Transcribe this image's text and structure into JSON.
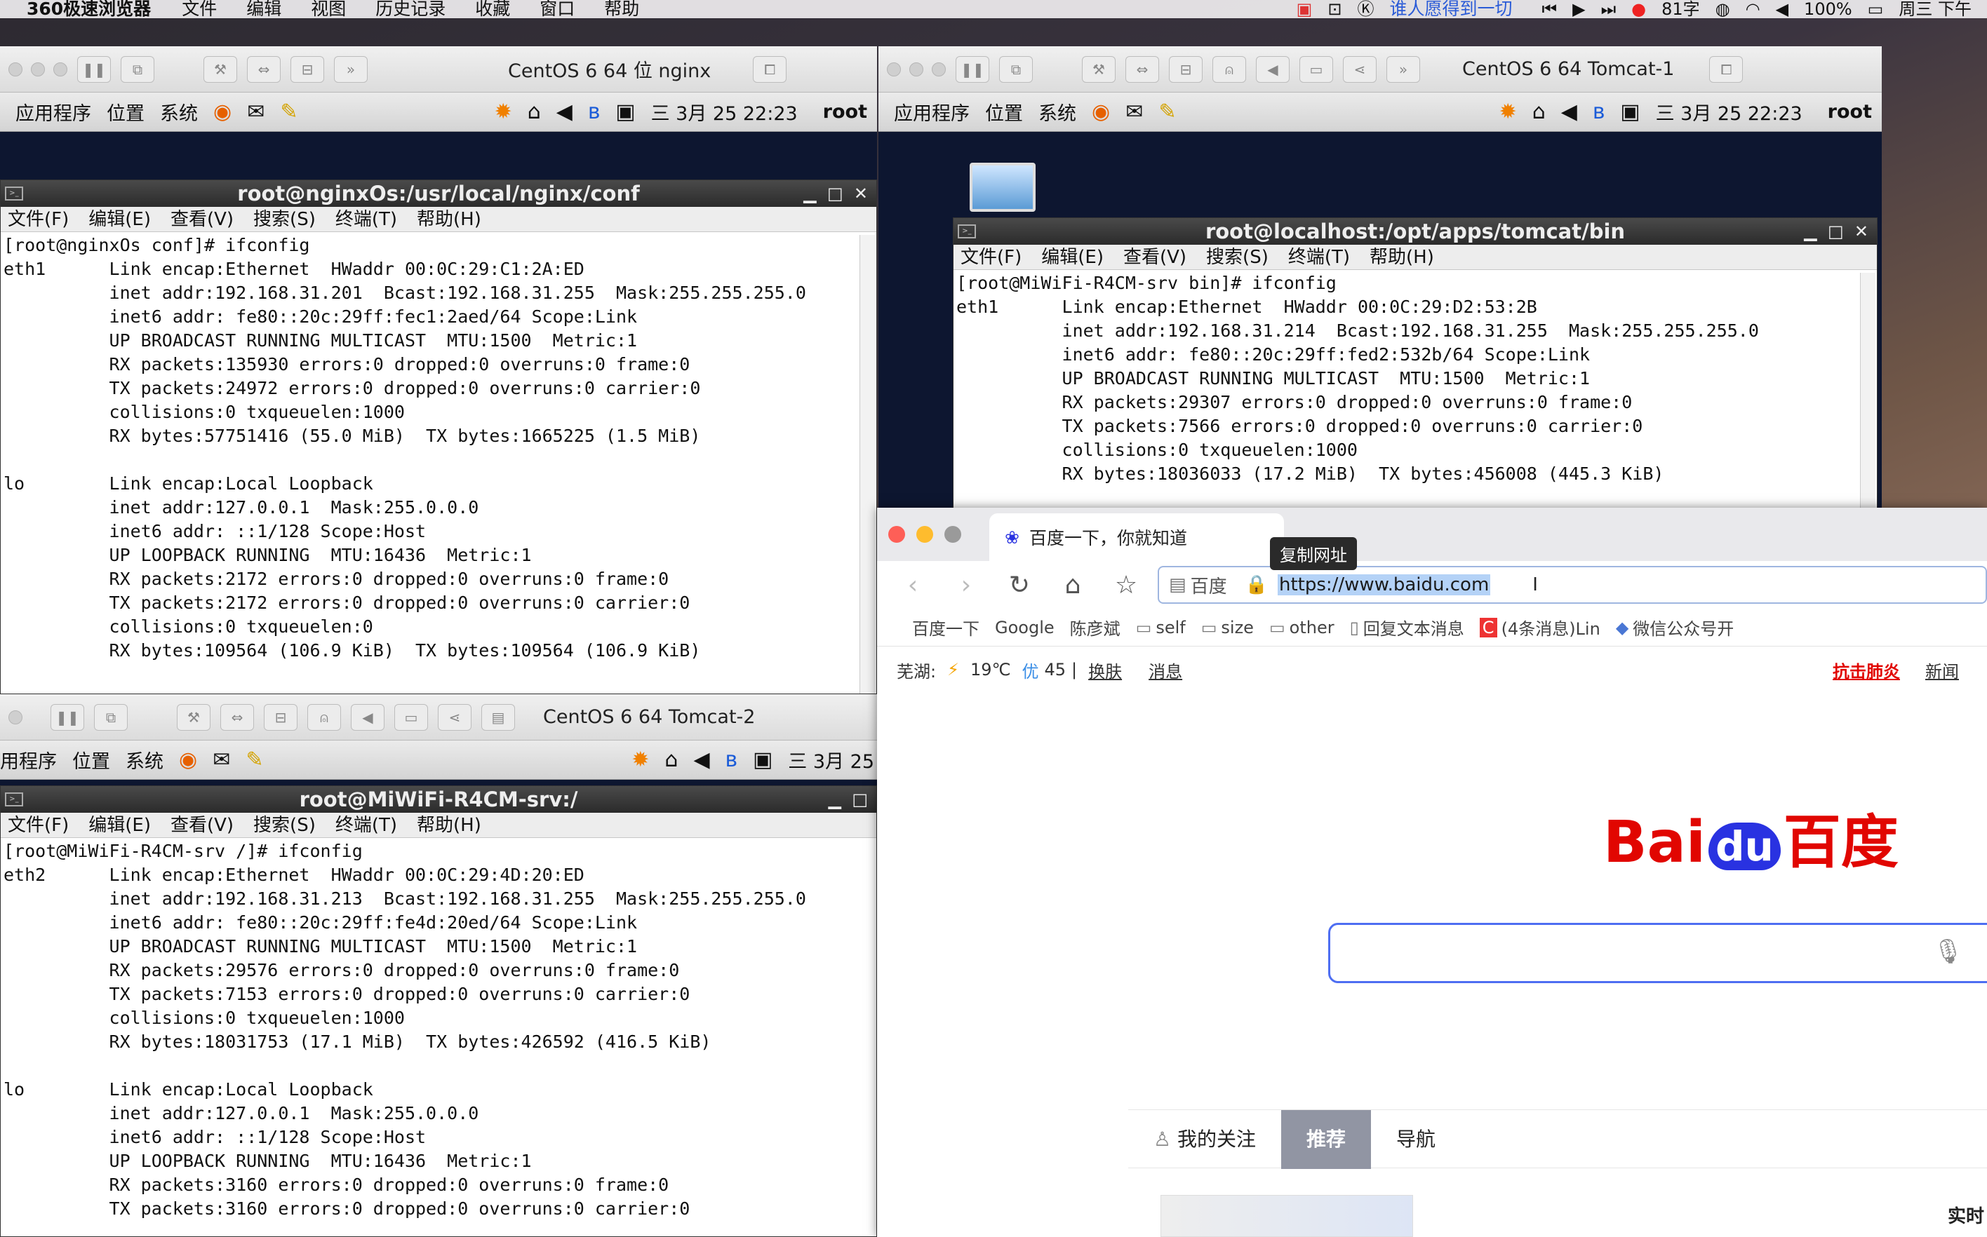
{
  "menubar": {
    "app": "360极速浏览器",
    "items": [
      "文件",
      "编辑",
      "视图",
      "历史记录",
      "收藏",
      "窗口",
      "帮助"
    ],
    "song": "谁人愿得到一切",
    "word_count": "81字",
    "battery": "100%",
    "clock": "周三 下午"
  },
  "vm1": {
    "title": "CentOS 6 64 位 nginx",
    "panel": {
      "apps": "应用程序",
      "places": "位置",
      "system": "系统",
      "clock": "三 3月 25 22:23",
      "user": "root"
    },
    "terminal": {
      "title": "root@nginxOs:/usr/local/nginx/conf",
      "menu": [
        "文件(F)",
        "编辑(E)",
        "查看(V)",
        "搜索(S)",
        "终端(T)",
        "帮助(H)"
      ],
      "lines": [
        "[root@nginxOs conf]# ifconfig",
        "eth1      Link encap:Ethernet  HWaddr 00:0C:29:C1:2A:ED",
        "          inet addr:192.168.31.201  Bcast:192.168.31.255  Mask:255.255.255.0",
        "          inet6 addr: fe80::20c:29ff:fec1:2aed/64 Scope:Link",
        "          UP BROADCAST RUNNING MULTICAST  MTU:1500  Metric:1",
        "          RX packets:135930 errors:0 dropped:0 overruns:0 frame:0",
        "          TX packets:24972 errors:0 dropped:0 overruns:0 carrier:0",
        "          collisions:0 txqueuelen:1000",
        "          RX bytes:57751416 (55.0 MiB)  TX bytes:1665225 (1.5 MiB)",
        "",
        "lo        Link encap:Local Loopback",
        "          inet addr:127.0.0.1  Mask:255.0.0.0",
        "          inet6 addr: ::1/128 Scope:Host",
        "          UP LOOPBACK RUNNING  MTU:16436  Metric:1",
        "          RX packets:2172 errors:0 dropped:0 overruns:0 frame:0",
        "          TX packets:2172 errors:0 dropped:0 overruns:0 carrier:0",
        "          collisions:0 txqueuelen:0",
        "          RX bytes:109564 (106.9 KiB)  TX bytes:109564 (106.9 KiB)"
      ]
    }
  },
  "vm2": {
    "title": "CentOS 6 64 Tomcat-1",
    "panel": {
      "apps": "应用程序",
      "places": "位置",
      "system": "系统",
      "clock": "三 3月 25 22:23",
      "user": "root"
    },
    "terminal": {
      "title": "root@localhost:/opt/apps/tomcat/bin",
      "menu": [
        "文件(F)",
        "编辑(E)",
        "查看(V)",
        "搜索(S)",
        "终端(T)",
        "帮助(H)"
      ],
      "lines": [
        "[root@MiWiFi-R4CM-srv bin]# ifconfig",
        "eth1      Link encap:Ethernet  HWaddr 00:0C:29:D2:53:2B",
        "          inet addr:192.168.31.214  Bcast:192.168.31.255  Mask:255.255.255.0",
        "          inet6 addr: fe80::20c:29ff:fed2:532b/64 Scope:Link",
        "          UP BROADCAST RUNNING MULTICAST  MTU:1500  Metric:1",
        "          RX packets:29307 errors:0 dropped:0 overruns:0 frame:0",
        "          TX packets:7566 errors:0 dropped:0 overruns:0 carrier:0",
        "          collisions:0 txqueuelen:1000",
        "          RX bytes:18036033 (17.2 MiB)  TX bytes:456008 (445.3 KiB)"
      ]
    }
  },
  "vm3": {
    "title": "CentOS 6 64 Tomcat-2",
    "panel": {
      "apps": "用程序",
      "places": "位置",
      "system": "系统",
      "clock": "三 3月 25"
    },
    "terminal": {
      "title": "root@MiWiFi-R4CM-srv:/",
      "menu": [
        "文件(F)",
        "编辑(E)",
        "查看(V)",
        "搜索(S)",
        "终端(T)",
        "帮助(H)"
      ],
      "lines": [
        "[root@MiWiFi-R4CM-srv /]# ifconfig",
        "eth2      Link encap:Ethernet  HWaddr 00:0C:29:4D:20:ED",
        "          inet addr:192.168.31.213  Bcast:192.168.31.255  Mask:255.255.255.0",
        "          inet6 addr: fe80::20c:29ff:fe4d:20ed/64 Scope:Link",
        "          UP BROADCAST RUNNING MULTICAST  MTU:1500  Metric:1",
        "          RX packets:29576 errors:0 dropped:0 overruns:0 frame:0",
        "          TX packets:7153 errors:0 dropped:0 overruns:0 carrier:0",
        "          collisions:0 txqueuelen:1000",
        "          RX bytes:18031753 (17.1 MiB)  TX bytes:426592 (416.5 KiB)",
        "",
        "lo        Link encap:Local Loopback",
        "          inet addr:127.0.0.1  Mask:255.0.0.0",
        "          inet6 addr: ::1/128 Scope:Host",
        "          UP LOOPBACK RUNNING  MTU:16436  Metric:1",
        "          RX packets:3160 errors:0 dropped:0 overruns:0 frame:0",
        "          TX packets:3160 errors:0 dropped:0 overruns:0 carrier:0"
      ]
    }
  },
  "browser": {
    "tab_title": "百度一下，你就知道",
    "tooltip": "复制网址",
    "cert_label": "百度",
    "url": "https://www.baidu.com",
    "bookmarks": [
      "百度一下",
      "Google",
      "陈彦斌",
      "self",
      "size",
      "other",
      "回复文本消息",
      "(4条消息)Lin",
      "微信公众号开"
    ],
    "weather": {
      "city": "芜湖:",
      "temp": "19℃",
      "aqi_label": "优",
      "aqi": "45",
      "skin": "换肤",
      "msg": "消息"
    },
    "top_links": {
      "hot": "抗击肺炎",
      "news": "新闻"
    },
    "logo": {
      "bai": "Bai",
      "du": "du",
      "cn": "百度"
    },
    "feed_tabs": [
      "我的关注",
      "推荐",
      "导航"
    ],
    "realtime": "实时"
  }
}
